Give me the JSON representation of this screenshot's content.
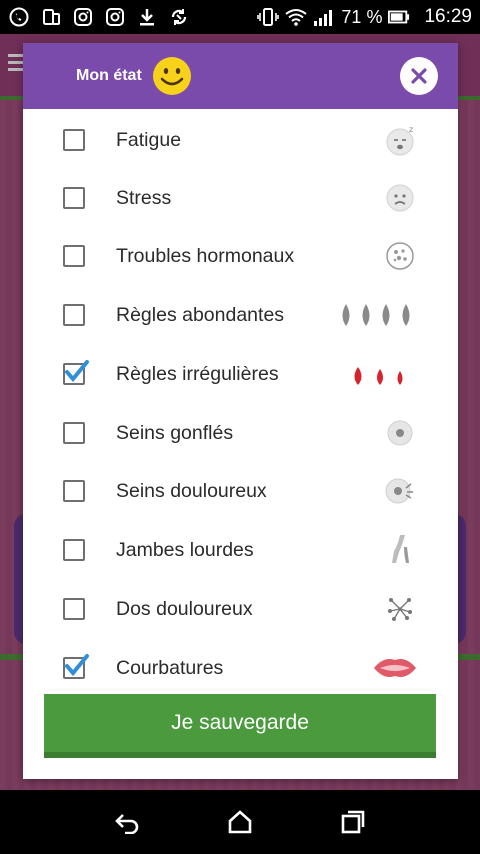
{
  "status_bar": {
    "battery": "71 %",
    "time": "16:29",
    "icons": [
      "phone-icon",
      "tablet-icon",
      "instagram-icon",
      "instagram-icon",
      "download-icon",
      "sync-icon",
      "vibrate-icon",
      "wifi-icon",
      "signal-icon",
      "battery-icon"
    ]
  },
  "modal": {
    "title": "Mon état",
    "header_color": "#7b4bab",
    "items": [
      {
        "label": "Fatigue",
        "checked": false,
        "icon": "sleepy-face-icon"
      },
      {
        "label": "Stress",
        "checked": false,
        "icon": "worried-face-icon"
      },
      {
        "label": "Troubles hormonaux",
        "checked": false,
        "icon": "hormone-cell-icon"
      },
      {
        "label": "Règles abondantes",
        "checked": false,
        "icon": "grey-drops-icon"
      },
      {
        "label": "Règles irrégulières",
        "checked": true,
        "icon": "red-drops-icon"
      },
      {
        "label": "Seins gonflés",
        "checked": false,
        "icon": "breast-icon"
      },
      {
        "label": "Seins douloureux",
        "checked": false,
        "icon": "breast-pain-icon"
      },
      {
        "label": "Jambes lourdes",
        "checked": false,
        "icon": "legs-icon"
      },
      {
        "label": "Dos douloureux",
        "checked": false,
        "icon": "back-pain-icon"
      },
      {
        "label": "Courbatures",
        "checked": true,
        "icon": "muscle-icon"
      }
    ],
    "save_label": "Je sauvegarde",
    "save_color": "#4b9a3e"
  },
  "nav": {
    "icons": [
      "back-icon",
      "home-icon",
      "recents-icon"
    ]
  }
}
